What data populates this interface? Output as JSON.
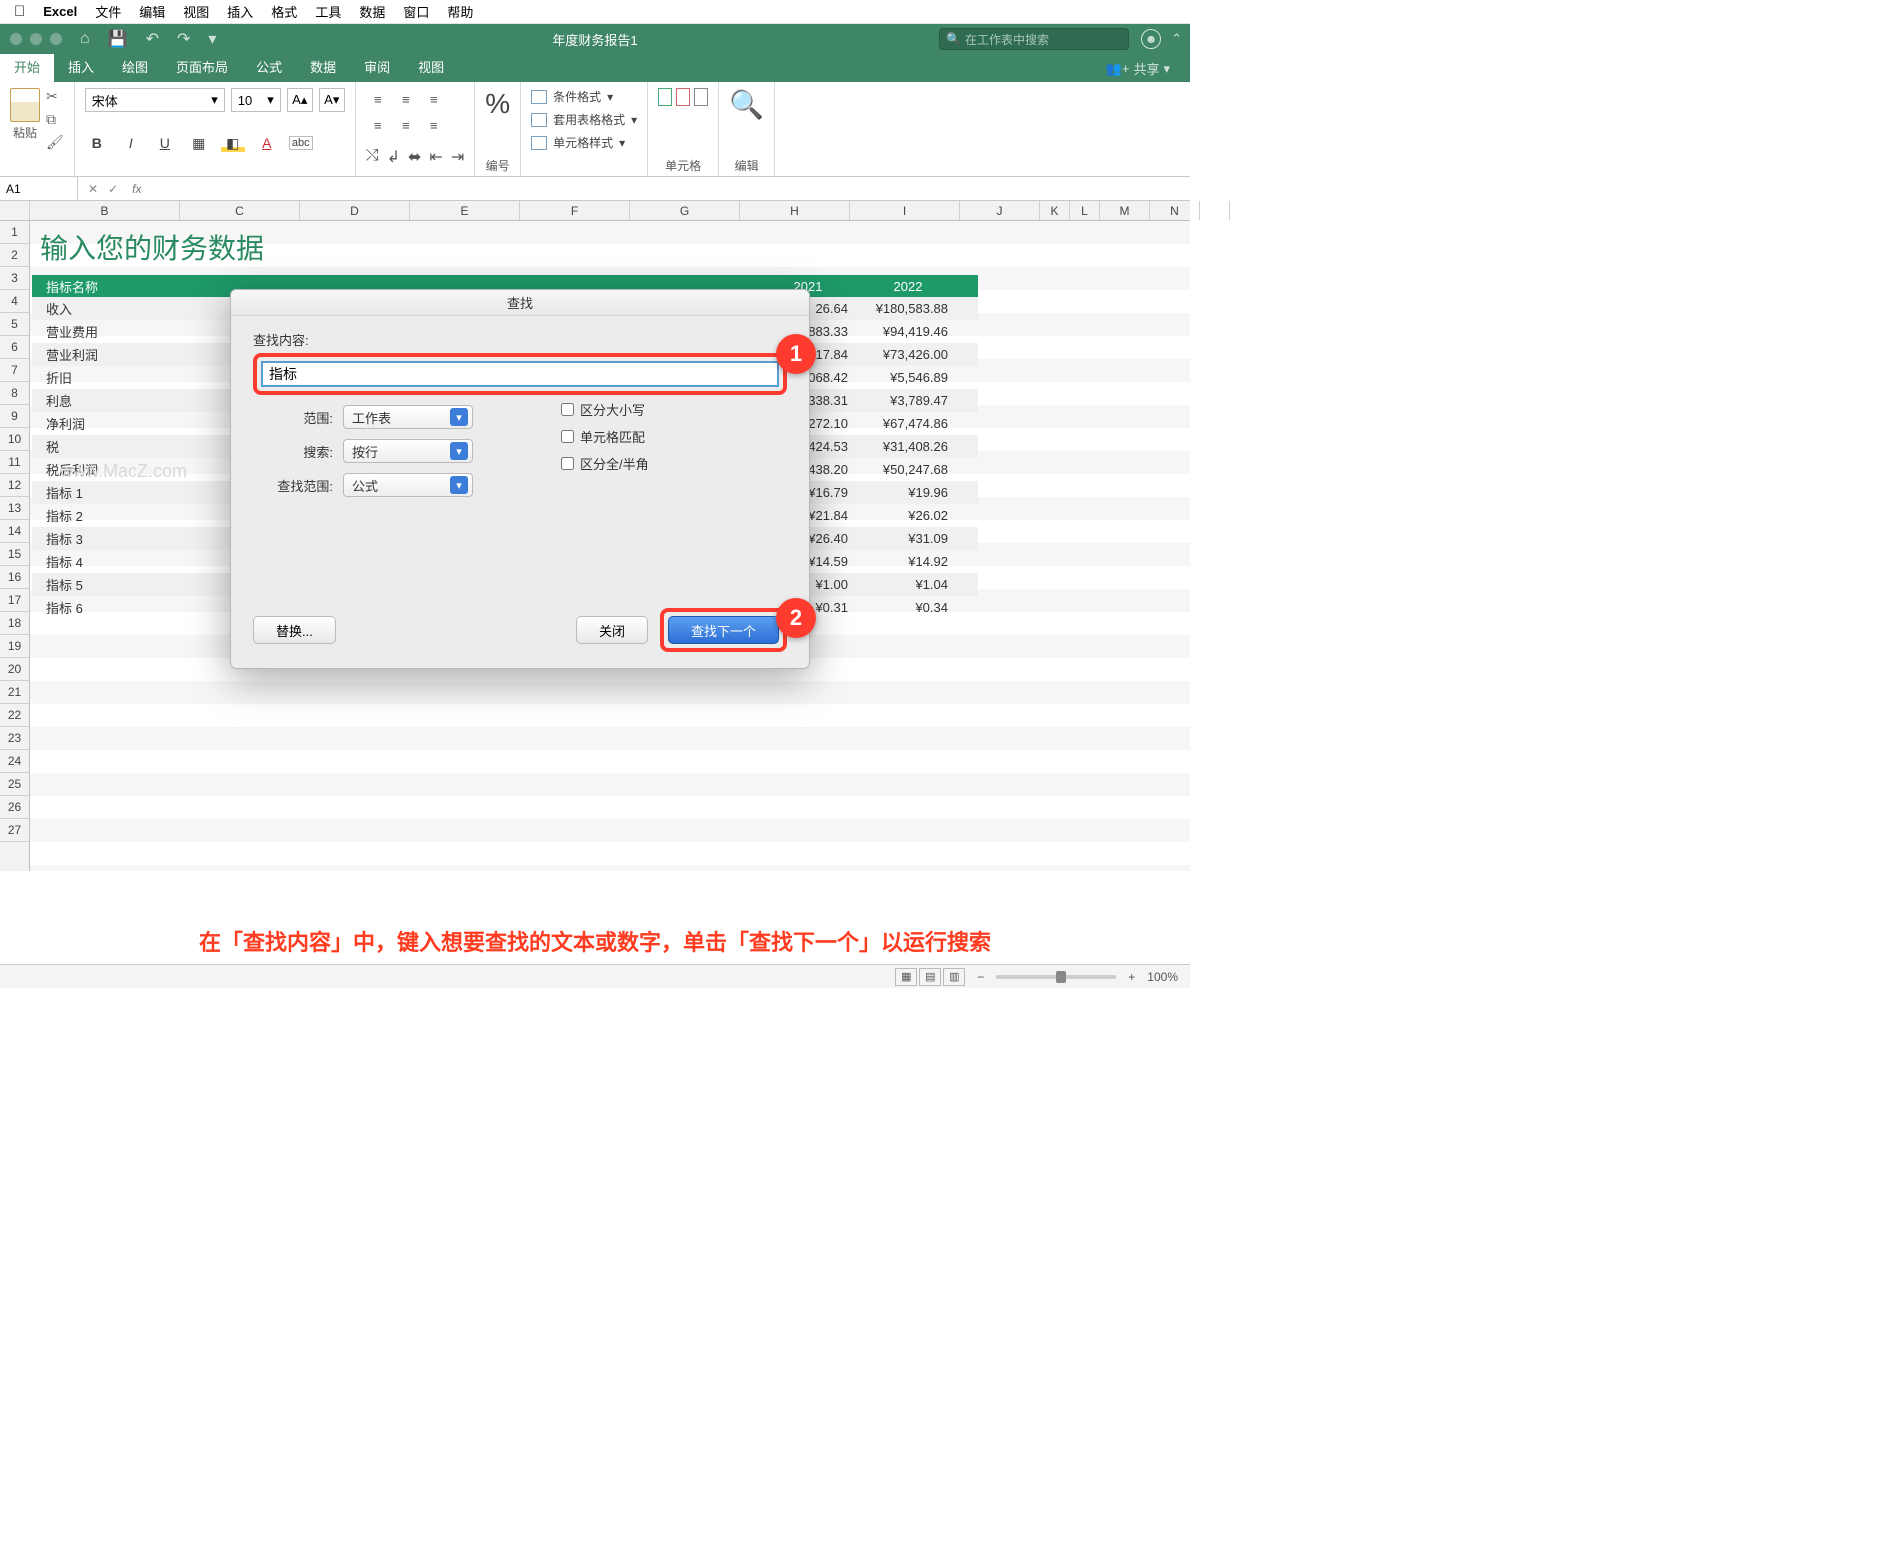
{
  "mac_menu": {
    "app": "Excel",
    "items": [
      "文件",
      "编辑",
      "视图",
      "插入",
      "格式",
      "工具",
      "数据",
      "窗口",
      "帮助"
    ]
  },
  "title_bar": {
    "doc": "年度财务报告1",
    "search_placeholder": "在工作表中搜索"
  },
  "tabs": {
    "items": [
      "开始",
      "插入",
      "绘图",
      "页面布局",
      "公式",
      "数据",
      "审阅",
      "视图"
    ],
    "active": 0,
    "share": "共享"
  },
  "ribbon": {
    "paste": "粘贴",
    "font_name": "宋体",
    "font_size": "10",
    "number_group": "编号",
    "cond_format": "条件格式",
    "table_format": "套用表格格式",
    "cell_style": "单元格样式",
    "cells_group": "单元格",
    "edit_group": "编辑"
  },
  "formula_bar": {
    "cell": "A1"
  },
  "sheet": {
    "big_title": "输入您的财务数据",
    "watermark": "www.MacZ.com",
    "columns": [
      "",
      "B",
      "C",
      "D",
      "E",
      "F",
      "G",
      "H",
      "I",
      "J",
      "K",
      "L",
      "M",
      "N"
    ],
    "header_col": "指标名称",
    "years": [
      "2021",
      "2022"
    ],
    "rows": [
      {
        "name": "收入",
        "v2021": "26.64",
        "v2022": "¥180,583.88"
      },
      {
        "name": "营业费用",
        "v2021": "883.33",
        "v2022": "¥94,419.46"
      },
      {
        "name": "营业利润",
        "v2021": "317.84",
        "v2022": "¥73,426.00"
      },
      {
        "name": "折旧",
        "v2021": "068.42",
        "v2022": "¥5,546.89"
      },
      {
        "name": "利息",
        "v2021": "338.31",
        "v2022": "¥3,789.47"
      },
      {
        "name": "净利润",
        "v2021": "272.10",
        "v2022": "¥67,474.86"
      },
      {
        "name": "税",
        "v2021": "424.53",
        "v2022": "¥31,408.26"
      },
      {
        "name": "税后利润",
        "v2021": "438.20",
        "v2022": "¥50,247.68"
      },
      {
        "name": "指标 1",
        "v2021": "¥16.79",
        "v2022": "¥19.96"
      },
      {
        "name": "指标 2",
        "v2021": "¥21.84",
        "v2022": "¥26.02"
      },
      {
        "name": "指标 3",
        "v2021": "¥26.40",
        "v2022": "¥31.09"
      },
      {
        "name": "指标 4",
        "v2021": "¥14.59",
        "v2022": "¥14.92"
      },
      {
        "name": "指标 5",
        "v2021": "¥1.00",
        "v2022": "¥1.04"
      },
      {
        "name": "指标 6",
        "v2021": "¥0.31",
        "v2022": "¥0.34"
      }
    ],
    "row_numbers": [
      1,
      2,
      3,
      4,
      5,
      6,
      7,
      8,
      9,
      10,
      11,
      12,
      13,
      14,
      15,
      16,
      17,
      18,
      19,
      20,
      21,
      22,
      23,
      24,
      25,
      26,
      27
    ]
  },
  "find_dialog": {
    "title": "查找",
    "label_content": "查找内容:",
    "input_value": "指标",
    "scope_label": "范围:",
    "scope_value": "工作表",
    "search_label": "搜索:",
    "search_value": "按行",
    "lookin_label": "查找范围:",
    "lookin_value": "公式",
    "chk_case": "区分大小写",
    "chk_match": "单元格匹配",
    "chk_width": "区分全/半角",
    "replace_btn": "替换...",
    "close_btn": "关闭",
    "next_btn": "查找下一个"
  },
  "hint_text": "在「查找内容」中，键入想要查找的文本或数字，单击「查找下一个」以运行搜索",
  "status": {
    "zoom": "100%"
  }
}
